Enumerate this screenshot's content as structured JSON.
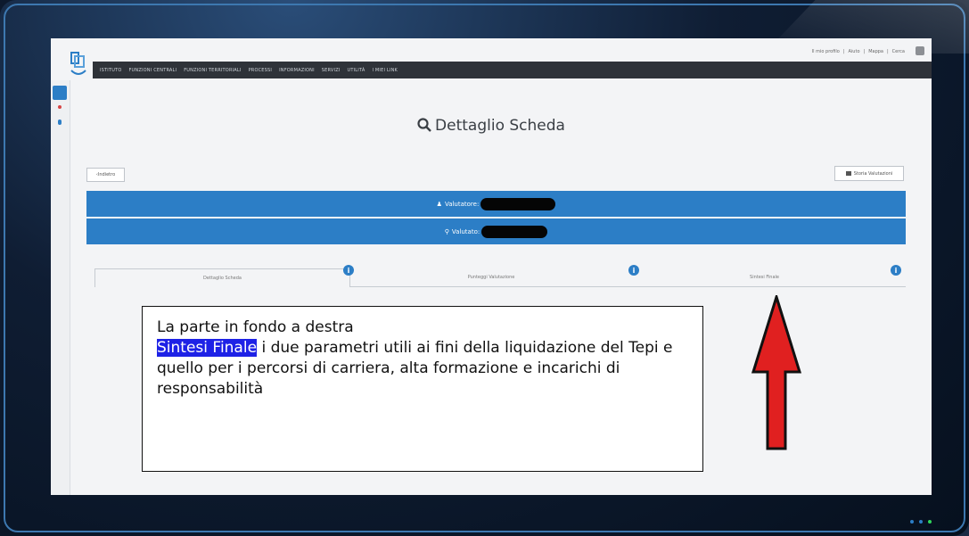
{
  "header": {
    "menu": [
      "ISTITUTO",
      "FUNZIONI CENTRALI",
      "FUNZIONI TERRITORIALI",
      "PROCESSI",
      "INFORMAZIONI",
      "SERVIZI",
      "UTILITÀ",
      "I MIEI LINK"
    ],
    "user_links": [
      "Il mio profilo",
      "Aiuto",
      "Mappa",
      "Cerca"
    ]
  },
  "page": {
    "title": "Dettaglio Scheda",
    "back_label": "Indietro",
    "history_label": "Storia Valutazioni"
  },
  "valutatore": {
    "label": "Valutatore:"
  },
  "valutato": {
    "label": "Valutato:"
  },
  "tabs": [
    {
      "label": "Dettaglio Scheda"
    },
    {
      "label": "Punteggi Valutazione"
    },
    {
      "label": "Sintesi Finale"
    }
  ],
  "note": {
    "line1": "La parte in fondo a destra",
    "highlight": "Sintesi Finale",
    "rest": " i due parametri utili ai fini della liquidazione del Tepi e quello per i percorsi di carriera, alta formazione e incarichi di responsabilità"
  },
  "colors": {
    "primary": "#2c7ec6",
    "topbar": "#2f3339",
    "arrow": "#e02020",
    "highlight": "#1e22e6"
  },
  "icons": {
    "search": "search-icon",
    "info": "info-icon",
    "user": "user-icon",
    "arrow": "red-up-arrow"
  }
}
